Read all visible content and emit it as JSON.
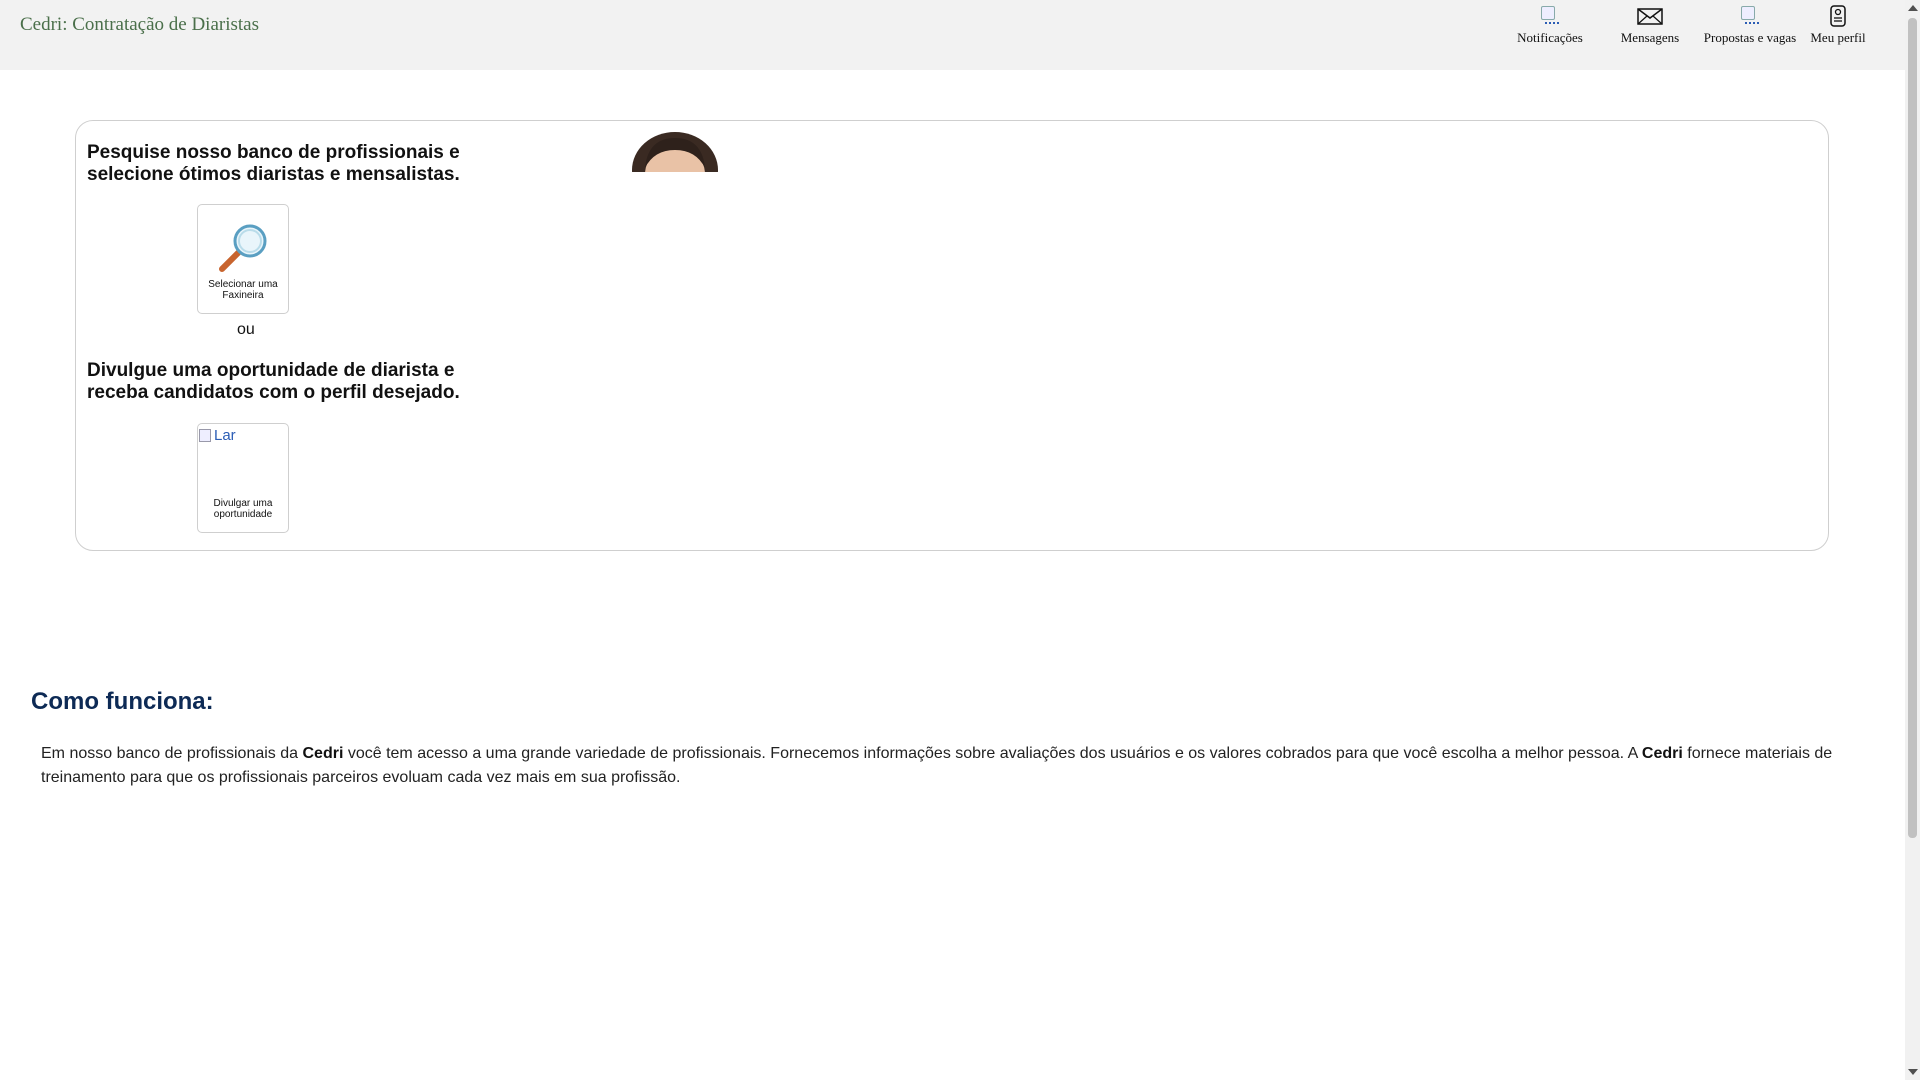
{
  "header": {
    "brand": "Cedri: Contratação de Diaristas",
    "nav": {
      "notifications": "Notificações",
      "messages": "Mensagens",
      "proposals": "Propostas e vagas",
      "profile": "Meu perfil "
    }
  },
  "card": {
    "search_headline": "Pesquise nosso banco de profissionais e selecione ótimos diaristas e mensalistas.",
    "select_tile_label": "Selecionar uma Faxineira",
    "or_text": "ou",
    "publish_headline": "Divulgue uma oportunidade de diarista e receba candidatos com o perfil desejado.",
    "publish_image_alt": "Lar",
    "publish_tile_label": "Divulgar uma oportunidade"
  },
  "how": {
    "title": "Como funciona:",
    "p1": "Em nosso banco de profissionais da ",
    "brand1": "Cedri",
    "p2": " você tem acesso a uma grande variedade de profissionais. Fornecemos informações sobre avaliações dos usuários e os valores cobrados para que você escolha a melhor pessoa. A ",
    "brand2": "Cedri",
    "p3": " fornece materiais de treinamento para que os profissionais parceiros evoluam cada vez mais em sua profissão."
  },
  "icons": {
    "notifications": "broken-image-icon",
    "messages": "envelope-icon",
    "proposals": "broken-image-icon",
    "profile": "user-card-icon",
    "search": "magnifier-icon"
  }
}
